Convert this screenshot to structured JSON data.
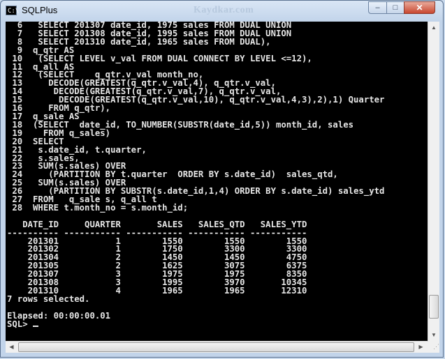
{
  "window": {
    "title": "SQLPlus",
    "watermark": "Kaydkar.com",
    "icon_text": "C:\\",
    "buttons": {
      "minimize": "–",
      "maximize": "□",
      "close": "✕"
    }
  },
  "console": {
    "code_lines": [
      "  6   SELECT 201307 date_id, 1975 sales FROM DUAL UNION",
      "  7   SELECT 201308 date_id, 1995 sales FROM DUAL UNION",
      "  8   SELECT 201310 date_id, 1965 sales FROM DUAL),",
      "  9  q_qtr AS",
      " 10   (SELECT LEVEL v_val FROM DUAL CONNECT BY LEVEL <=12),",
      " 11  q_all AS",
      " 12   (SELECT    q_qtr.v_val month_no,",
      " 13     DECODE(GREATEST(q_qtr.v_val,4), q_qtr.v_val,",
      " 14      DECODE(GREATEST(q_qtr.v_val,7), q_qtr.v_val,",
      " 15       DECODE(GREATEST(q_qtr.v_val,10), q_qtr.v_val,4,3),2),1) Quarter",
      " 16     FROM q_qtr),",
      " 17  q_sale AS",
      " 18  (SELECT  date_id, TO_NUMBER(SUBSTR(date_id,5)) month_id, sales",
      " 19    FROM q_sales)",
      " 20  SELECT",
      " 21   s.date_id, t.quarter,",
      " 22   s.sales,",
      " 23   SUM(s.sales) OVER",
      " 24     (PARTITION BY t.quarter  ORDER BY s.date_id)  sales_qtd,",
      " 25   SUM(s.sales) OVER",
      " 26     (PARTITION BY SUBSTR(s.date_id,1,4) ORDER BY s.date_id) sales_ytd",
      " 27  FROM   q_sale s, q_all t",
      " 28  WHERE t.month_no = s.month_id;"
    ],
    "result": {
      "columns": [
        "DATE_ID",
        "QUARTER",
        "SALES",
        "SALES_QTD",
        "SALES_YTD"
      ],
      "rows": [
        [
          "201301",
          "1",
          "1550",
          "1550",
          "1550"
        ],
        [
          "201302",
          "1",
          "1750",
          "3300",
          "3300"
        ],
        [
          "201304",
          "2",
          "1450",
          "1450",
          "4750"
        ],
        [
          "201305",
          "2",
          "1625",
          "3075",
          "6375"
        ],
        [
          "201307",
          "3",
          "1975",
          "1975",
          "8350"
        ],
        [
          "201308",
          "3",
          "1995",
          "3970",
          "10345"
        ],
        [
          "201310",
          "4",
          "1965",
          "1965",
          "12310"
        ]
      ]
    },
    "rows_selected": "7 rows selected.",
    "elapsed": "Elapsed: 00:00:00.01",
    "prompt": "SQL> "
  }
}
